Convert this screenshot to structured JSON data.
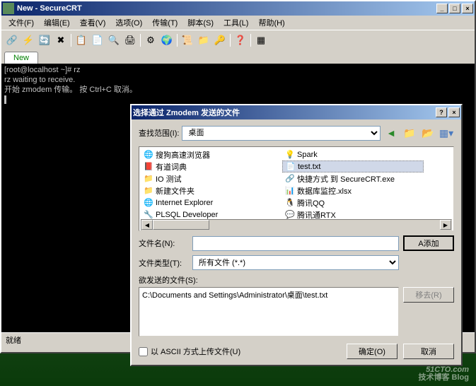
{
  "window": {
    "title": "New - SecureCRT",
    "menus": [
      "文件(F)",
      "编辑(E)",
      "查看(V)",
      "选项(O)",
      "传输(T)",
      "脚本(S)",
      "工具(L)",
      "帮助(H)"
    ],
    "tab": "New",
    "status": "就绪"
  },
  "terminal": {
    "line1": "[root@localhost ~]# rz",
    "line2": "rz waiting to receive.",
    "line3": "开始 zmodem 传输。 按 Ctrl+C 取消。"
  },
  "dialog": {
    "title": "选择通过 Zmodem 发送的文件",
    "look_in_label": "查找范围(I):",
    "look_in_value": "桌面",
    "files": {
      "col1": [
        {
          "name": "搜狗高速浏览器",
          "icon": "🌐"
        },
        {
          "name": "有道词典",
          "icon": "📕"
        },
        {
          "name": "IO 测试",
          "icon": "📁"
        },
        {
          "name": "新建文件夹",
          "icon": "📁"
        },
        {
          "name": "Internet Explorer",
          "icon": "🌐"
        },
        {
          "name": "PLSQL Developer",
          "icon": "🔧"
        }
      ],
      "col2": [
        {
          "name": "Spark",
          "icon": "💡"
        },
        {
          "name": "test.txt",
          "icon": "📄",
          "selected": true
        },
        {
          "name": "快捷方式 到 SecureCRT.exe",
          "icon": "🔗"
        },
        {
          "name": "数据库监控.xlsx",
          "icon": "📊"
        },
        {
          "name": "腾讯QQ",
          "icon": "🐧"
        },
        {
          "name": "腾讯通RTX",
          "icon": "💬"
        }
      ]
    },
    "filename_label": "文件名(N):",
    "filename_value": "",
    "filetype_label": "文件类型(T):",
    "filetype_value": "所有文件 (*.*)",
    "add_btn": "A添加",
    "send_label": "欲发送的文件(S):",
    "send_files": "C:\\Documents and Settings\\Administrator\\桌面\\test.txt",
    "remove_btn": "移去(R)",
    "ascii_label": "以 ASCII 方式上传文件(U)",
    "ok_btn": "确定(O)",
    "cancel_btn": "取消"
  },
  "watermark": {
    "main": "51CTO.com",
    "sub": "技术博客   Blog"
  }
}
